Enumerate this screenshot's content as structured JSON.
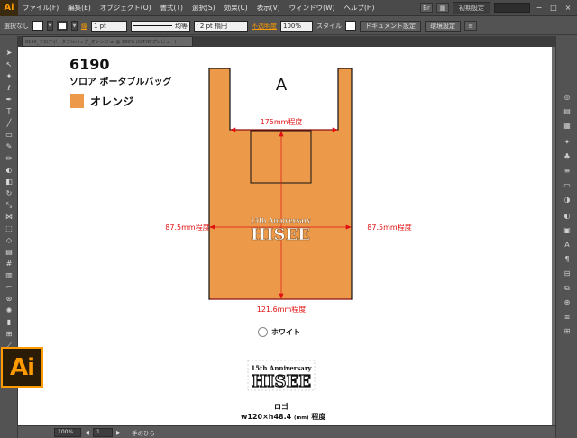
{
  "menubar": {
    "logo": "Ai",
    "items": [
      "ファイル(F)",
      "編集(E)",
      "オブジェクト(O)",
      "書式(T)",
      "選択(S)",
      "効果(C)",
      "表示(V)",
      "ウィンドウ(W)",
      "ヘルプ(H)"
    ],
    "workspace": "初期設定",
    "window_buttons": [
      "−",
      "□",
      "×"
    ]
  },
  "controlbar": {
    "selection_status": "選択なし",
    "stroke_label": "線",
    "stroke_weight": "1 pt",
    "stroke_profile": "均等",
    "brush": "2 pt 楕円",
    "opacity_label": "不透明度",
    "opacity_value": "100%",
    "style_label": "スタイル",
    "doc_setup_button": "ドキュメント設定",
    "prefs_button": "環境設定"
  },
  "document_tab": {
    "title": "6190_ソロアポータブルバッグ_オレンジ.ai @ 100% (CMYK/プレビュー)"
  },
  "artboard": {
    "product_code": "6190",
    "product_name": "ソロア ポータブルバッグ",
    "color_name": "オレンジ",
    "bag_label": "A",
    "dims": {
      "top_width": "175mm程度",
      "left_width": "87.5mm程度",
      "right_width": "87.5mm程度",
      "bottom_width": "121.6mm程度"
    },
    "logo_line1": "15th Anniversary",
    "logo_line2": "HISEE",
    "white_option": "ホワイト",
    "logo_caption": "ロゴ",
    "logo_size_main": "w120×h48.4",
    "logo_size_unit": "(mm)",
    "logo_size_suffix": "程度"
  },
  "colors": {
    "bag_orange": "#ec9a4a",
    "dim_red": "#e01010",
    "accent": "#ff9a00"
  },
  "statusbar": {
    "zoom": "100%",
    "page": "1",
    "tool_name": "手のひら"
  },
  "badge": {
    "text": "Ai"
  }
}
